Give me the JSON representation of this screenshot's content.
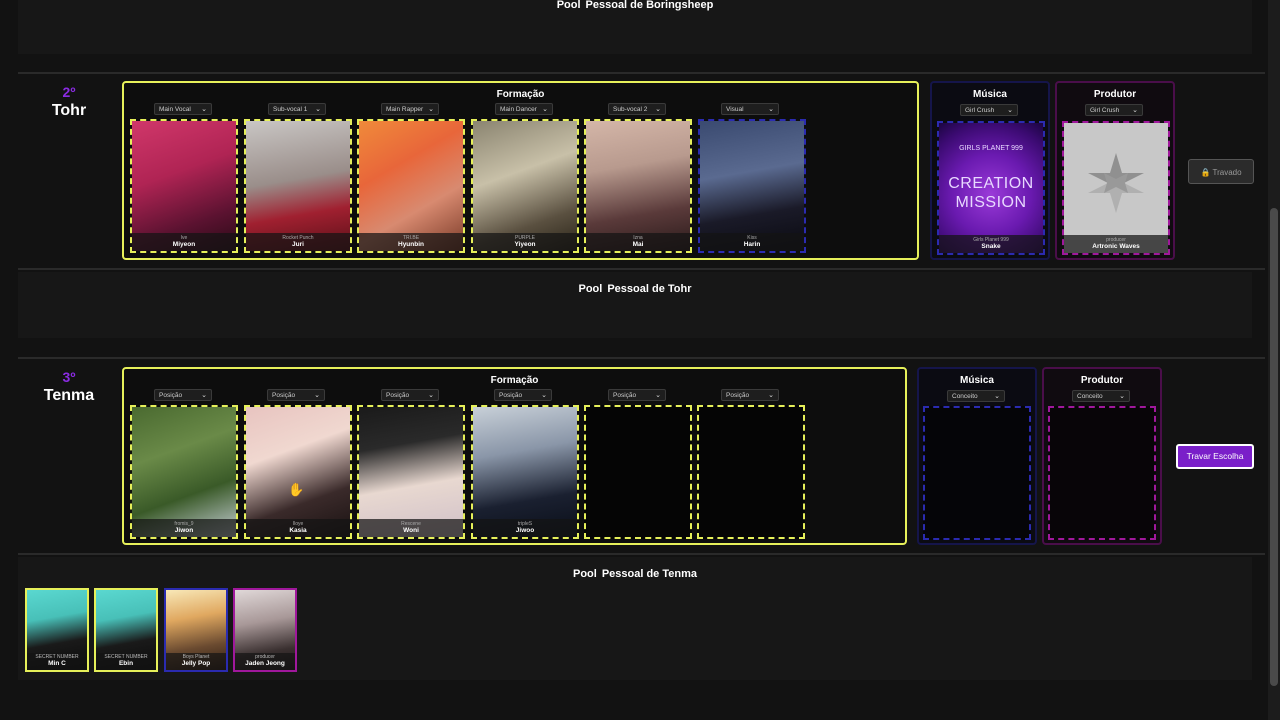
{
  "pool_top": {
    "title_bold": "Pool",
    "title_rest": "Pessoal de Boringsheep"
  },
  "tohr": {
    "rank": "2º",
    "name": "Tohr",
    "formation_title": "Formação",
    "music_title": "Música",
    "producer_title": "Produtor",
    "music_select": "Girl Crush",
    "producer_select": "Girl Crush",
    "positions": [
      "Main Vocal",
      "Sub-vocal 1",
      "Main Rapper",
      "Main Dancer",
      "Sub-vocal 2",
      "Visual"
    ],
    "cards": [
      {
        "sub": "Ive",
        "name": "Miyeon"
      },
      {
        "sub": "Rocket Punch",
        "name": "Juri"
      },
      {
        "sub": "TRI.BE",
        "name": "Hyunbin"
      },
      {
        "sub": "PURPLE",
        "name": "Yiyeon"
      },
      {
        "sub": "Izna",
        "name": "Mai"
      },
      {
        "sub": "Kiss",
        "name": "Harin"
      }
    ],
    "music_card": {
      "overlay_small": "GIRLS PLANET 999",
      "overlay_big1": "CREATION",
      "overlay_big2": "MISSION",
      "sub": "Girls Planet 999",
      "name": "Snake"
    },
    "producer_card": {
      "sub": "producer",
      "name": "Artronic Waves"
    },
    "lock_button": "🔒 Travado"
  },
  "pool_tohr": {
    "title_bold": "Pool",
    "title_rest": "Pessoal de Tohr"
  },
  "tenma": {
    "rank": "3º",
    "name": "Tenma",
    "formation_title": "Formação",
    "music_title": "Música",
    "producer_title": "Produtor",
    "music_select": "Conceito",
    "producer_select": "Conceito",
    "positions": [
      "Posição",
      "Posição",
      "Posição",
      "Posição",
      "Posição",
      "Posição"
    ],
    "cards": [
      {
        "sub": "fromis_9",
        "name": "Jiwon"
      },
      {
        "sub": "Iloye",
        "name": "Kasia"
      },
      {
        "sub": "Rescene",
        "name": "Woni"
      },
      {
        "sub": "tripleS",
        "name": "Jiwoo"
      }
    ],
    "lock_button": "Travar Escolha"
  },
  "pool_tenma": {
    "title_bold": "Pool",
    "title_rest": "Pessoal de Tenma",
    "items": [
      {
        "sub": "SECRET NUMBER",
        "name": "Min C"
      },
      {
        "sub": "SECRET NUMBER",
        "name": "Ebin"
      },
      {
        "sub": "Boys Planet",
        "name": "Jelly Pop"
      },
      {
        "sub": "producer",
        "name": "Jaden Jeong"
      }
    ]
  },
  "colors": {
    "accent": "#8a2be2",
    "formation_border": "#e6f05a",
    "music_border": "#2b2bb0",
    "producer_border": "#a0189c",
    "lock_button": "#7a1fc9"
  }
}
